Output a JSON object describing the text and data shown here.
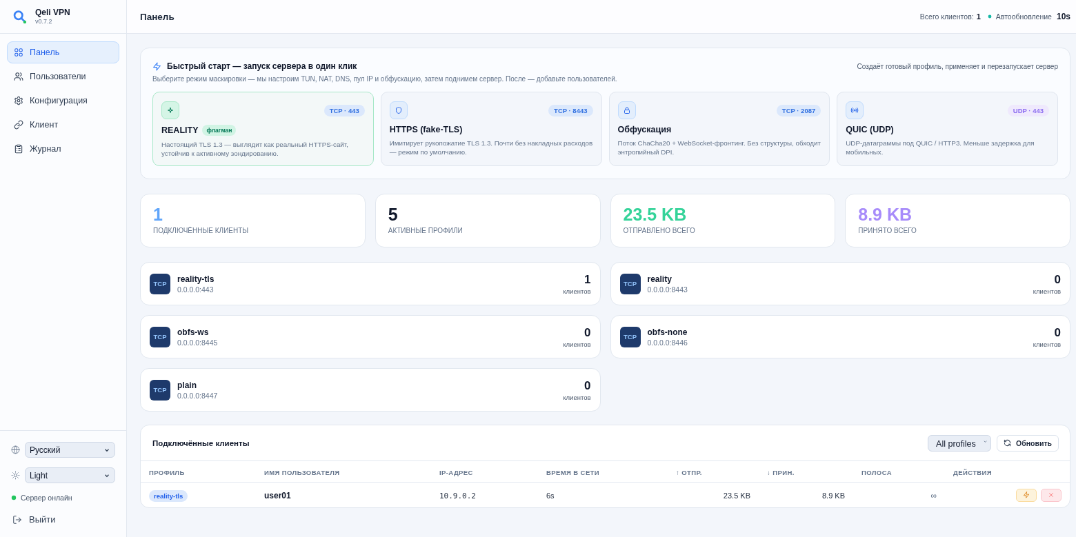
{
  "brand": {
    "name": "Qeli VPN",
    "version": "v0.7.2"
  },
  "sidebar": {
    "items": [
      {
        "label": "Панель",
        "kind": "dashboard",
        "selected": true
      },
      {
        "label": "Пользователи",
        "kind": "users",
        "selected": false
      },
      {
        "label": "Конфигурация",
        "kind": "config",
        "selected": false
      },
      {
        "label": "Клиент",
        "kind": "client",
        "selected": false
      },
      {
        "label": "Журнал",
        "kind": "log",
        "selected": false
      }
    ],
    "language": {
      "value": "Русский"
    },
    "theme": {
      "value": "Light"
    },
    "server_status": {
      "label": "Сервер онлайн",
      "online": true
    },
    "logout": {
      "label": "Выйти"
    }
  },
  "header": {
    "title": "Панель",
    "total_clients": {
      "label": "Всего клиентов:",
      "value": "1"
    },
    "autorefresh": {
      "label": "Автообновление",
      "interval": "10s",
      "on": true
    }
  },
  "quick_start": {
    "title": "Быстрый старт — запуск сервера в один клик",
    "subtitle": "Выберите режим маскировки — мы настроим TUN, NAT, DNS, пул IP и обфускацию, затем поднимем сервер. После — добавьте пользователей.",
    "note": "Создаёт готовый профиль, применяет и перезапускает сервер",
    "modes": [
      {
        "kind": "reality",
        "title": "REALITY",
        "tag": "флагман",
        "badge": {
          "text": "TCP · 443",
          "kind": "tcp"
        },
        "description": "Настоящий TLS 1.3 — выглядит как реальный HTTPS-сайт, устойчив к активному зондированию.",
        "selected": true
      },
      {
        "kind": "tls",
        "title": "HTTPS (fake-TLS)",
        "badge": {
          "text": "TCP · 8443",
          "kind": "tcp"
        },
        "description": "Имитирует рукопожатие TLS 1.3. Почти без накладных расходов — режим по умолчанию.",
        "selected": false
      },
      {
        "kind": "obfs",
        "title": "Обфускация",
        "badge": {
          "text": "TCP · 2087",
          "kind": "tcp"
        },
        "description": "Поток ChaCha20 + WebSocket-фронтинг. Без структуры, обходит энтропийный DPI.",
        "selected": false
      },
      {
        "kind": "quic",
        "title": "QUIC (UDP)",
        "badge": {
          "text": "UDP · 443",
          "kind": "udp"
        },
        "description": "UDP-датаграммы под QUIC / HTTP3. Меньше задержка для мобильных.",
        "selected": false
      }
    ]
  },
  "stats": [
    {
      "value": "1",
      "label": "ПОДКЛЮЧЁННЫЕ КЛИЕНТЫ",
      "color": "#60a5fa"
    },
    {
      "value": "5",
      "label": "АКТИВНЫЕ ПРОФИЛИ",
      "color": "#0f172a"
    },
    {
      "value": "23.5 KB",
      "label": "ОТПРАВЛЕНО ВСЕГО",
      "color": "#34d399"
    },
    {
      "value": "8.9 KB",
      "label": "ПРИНЯТО ВСЕГО",
      "color": "#a78bfa"
    }
  ],
  "profiles": [
    {
      "proto": "TCP",
      "name": "reality-tls",
      "address": "0.0.0.0:443",
      "count": "1",
      "count_label": "клиентов"
    },
    {
      "proto": "TCP",
      "name": "reality",
      "address": "0.0.0.0:8443",
      "count": "0",
      "count_label": "клиентов"
    },
    {
      "proto": "TCP",
      "name": "obfs-ws",
      "address": "0.0.0.0:8445",
      "count": "0",
      "count_label": "клиентов"
    },
    {
      "proto": "TCP",
      "name": "obfs-none",
      "address": "0.0.0.0:8446",
      "count": "0",
      "count_label": "клиентов"
    },
    {
      "proto": "TCP",
      "name": "plain",
      "address": "0.0.0.0:8447",
      "count": "0",
      "count_label": "клиентов"
    }
  ],
  "clients": {
    "title": "Подключённые клиенты",
    "filter": {
      "value": "All profiles"
    },
    "refresh": {
      "label": "Обновить"
    },
    "table": {
      "columns": [
        "ПРОФИЛЬ",
        "ИМЯ ПОЛЬЗОВАТЕЛЯ",
        "IP-АДРЕС",
        "ВРЕМЯ В СЕТИ",
        "↑ ОТПР.",
        "↓ ПРИН.",
        "ПОЛОСА",
        "ДЕЙСТВИЯ"
      ],
      "rows": [
        {
          "profile": "reality-tls",
          "user": "user01",
          "ip": "10.9.0.2",
          "uptime": "6s",
          "sent": "23.5 KB",
          "received": "8.9 KB",
          "bandwidth": "∞"
        }
      ]
    }
  }
}
